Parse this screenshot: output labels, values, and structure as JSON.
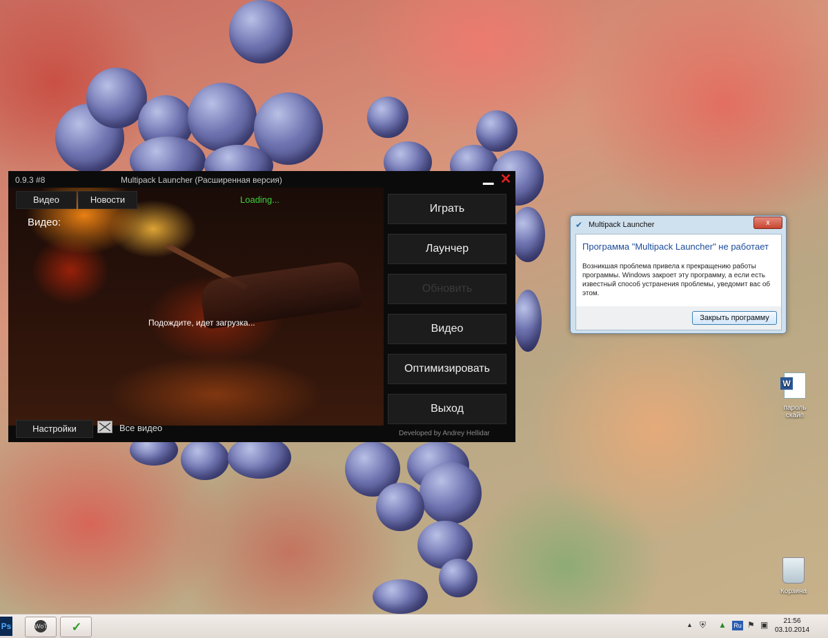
{
  "launcher": {
    "version": "0.9.3 #8",
    "title": "Multipack Launcher (Расширенная версия)",
    "minimize_glyph": "▁",
    "close_glyph": "✕",
    "tabs": [
      {
        "label": "Видео"
      },
      {
        "label": "Новости"
      }
    ],
    "loading_text": "Loading...",
    "video_label": "Видео:",
    "wait_text": "Подождите, идет загрузка...",
    "menu": [
      {
        "label": "Играть",
        "enabled": true
      },
      {
        "label": "Лаунчер",
        "enabled": true
      },
      {
        "label": "Обновить",
        "enabled": false
      },
      {
        "label": "Видео",
        "enabled": true
      },
      {
        "label": "Оптимизировать",
        "enabled": true
      },
      {
        "label": "Выход",
        "enabled": true
      }
    ],
    "settings_label": "Настройки",
    "all_video_label": "Все видео",
    "checkbox_checked": true,
    "developer_credit": "Developed by Andrey Hellidar",
    "loading_color": "#3dd13d",
    "close_color": "#e02020"
  },
  "error_dialog": {
    "title": "Multipack Launcher",
    "close_glyph": "x",
    "heading": "Программа \"Multipack Launcher\" не работает",
    "message": "Возникшая проблема привела к прекращению работы программы. Windows закроет эту программу, а если есть известный способ устранения проблемы, уведомит вас об этом.",
    "button_label": "Закрыть программу",
    "heading_color": "#1b4b9a"
  },
  "desktop_icons": [
    {
      "label": "пароль скайп",
      "icon": "word-document-icon"
    },
    {
      "label": "Корзина",
      "icon": "recycle-bin-icon"
    }
  ],
  "taskbar": {
    "apps": [
      {
        "name": "Photoshop",
        "glyph": "Ps"
      },
      {
        "name": "World of Tanks",
        "glyph": "WoT"
      },
      {
        "name": "Multipack Launcher",
        "glyph": "✓"
      }
    ],
    "tray": {
      "show_hidden_glyph": "▲",
      "language": "Ru",
      "clock_time": "21:56",
      "clock_date": "03.10.2014"
    }
  }
}
